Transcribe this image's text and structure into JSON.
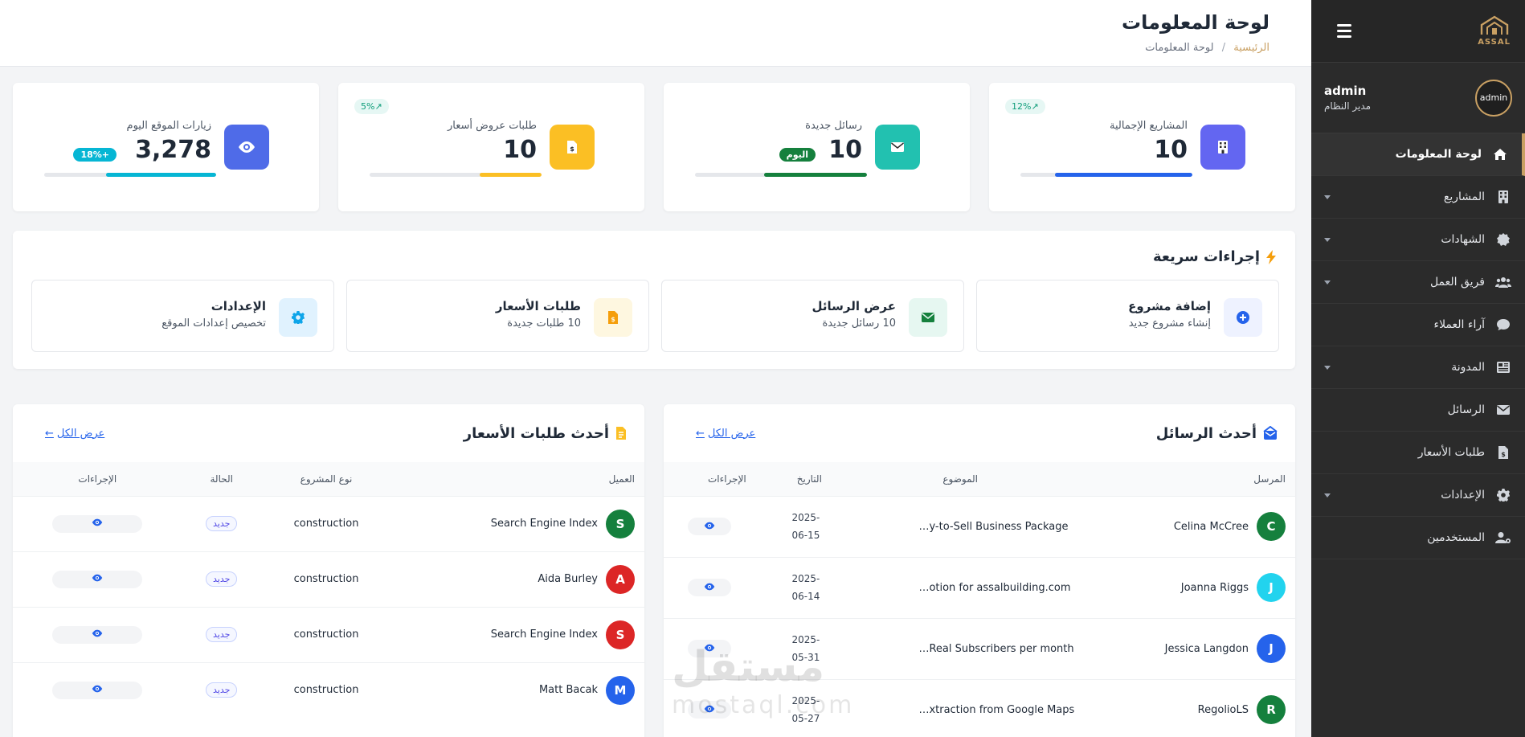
{
  "sidebar": {
    "logo_text": "ASSAL",
    "user": {
      "avatar_alt": "admin",
      "name": "admin",
      "role": "مدير النظام"
    },
    "items": [
      {
        "label": "لوحة المعلومات",
        "icon": "home-icon",
        "active": true,
        "caret": false
      },
      {
        "label": "المشاريع",
        "icon": "building-icon",
        "active": false,
        "caret": true
      },
      {
        "label": "الشهادات",
        "icon": "certificate-icon",
        "active": false,
        "caret": true
      },
      {
        "label": "فريق العمل",
        "icon": "team-icon",
        "active": false,
        "caret": true
      },
      {
        "label": "آراء العملاء",
        "icon": "comment-icon",
        "active": false,
        "caret": false
      },
      {
        "label": "المدونة",
        "icon": "newspaper-icon",
        "active": false,
        "caret": true
      },
      {
        "label": "الرسائل",
        "icon": "envelope-icon",
        "active": false,
        "caret": false
      },
      {
        "label": "طلبات الأسعار",
        "icon": "invoice-icon",
        "active": false,
        "caret": false
      },
      {
        "label": "الإعدادات",
        "icon": "gear-icon",
        "active": false,
        "caret": true
      },
      {
        "label": "المستخدمين",
        "icon": "user-cog-icon",
        "active": false,
        "caret": false
      }
    ]
  },
  "header": {
    "title": "لوحة المعلومات",
    "breadcrumb": {
      "home": "الرئيسية",
      "separator": "/",
      "current": "لوحة المعلومات"
    }
  },
  "stats": [
    {
      "label": "المشاريع الإجمالية",
      "value": "10",
      "pct": "12%",
      "color": "#6366f1",
      "bar_color": "#2563eb",
      "fill": 0.8,
      "icon": "building-icon"
    },
    {
      "label": "رسائل جديدة",
      "value": "10",
      "chip": "اليوم",
      "chip_color": "#15803d",
      "color": "#22c1b0",
      "bar_color": "#15803d",
      "fill": 0.6,
      "icon": "envelope-icon"
    },
    {
      "label": "طلبات عروض أسعار",
      "value": "10",
      "pct": "5%",
      "color": "#fbbf24",
      "bar_color": "#fbbf24",
      "fill": 0.36,
      "icon": "invoice-icon"
    },
    {
      "label": "زيارات الموقع اليوم",
      "value": "3,278",
      "chip": "+18%",
      "chip_color": "#06b6d4",
      "color": "#4f6be8",
      "bar_color": "#06b6d4",
      "fill": 0.64,
      "icon": "eye-icon"
    }
  ],
  "quick": {
    "title": "إجراءات سريعة",
    "actions": [
      {
        "title": "إضافة مشروع",
        "sub": "إنشاء مشروع جديد",
        "icon": "plus-circle-icon",
        "bg": "#eef2ff",
        "fg": "#2563eb"
      },
      {
        "title": "عرض الرسائل",
        "sub": "10 رسائل جديدة",
        "icon": "envelope-icon",
        "bg": "#e6f7f1",
        "fg": "#15803d"
      },
      {
        "title": "طلبات الأسعار",
        "sub": "10 طلبات جديدة",
        "icon": "invoice-icon",
        "bg": "#fef7e0",
        "fg": "#f59e0b"
      },
      {
        "title": "الإعدادات",
        "sub": "تخصيص إعدادات الموقع",
        "icon": "gear-icon",
        "bg": "#e0f2fe",
        "fg": "#0ea5e9"
      }
    ]
  },
  "messages": {
    "title": "أحدث الرسائل",
    "view_all": "عرض الكل",
    "columns": [
      "المرسل",
      "الموضوع",
      "التاريخ",
      "الإجراءات"
    ],
    "rows": [
      {
        "letter": "C",
        "color": "#15803d",
        "name": "Celina McCree",
        "subject": "…y-to-Sell Business Package",
        "date": "2025-06-15"
      },
      {
        "letter": "J",
        "color": "#22d3ee",
        "name": "Joanna Riggs",
        "subject": "…otion for assalbuilding.com",
        "date": "2025-06-14"
      },
      {
        "letter": "J",
        "color": "#2563eb",
        "name": "Jessica Langdon",
        "subject": "…Real Subscribers per month",
        "date": "2025-05-31"
      },
      {
        "letter": "R",
        "color": "#15803d",
        "name": "RegolioLS",
        "subject": "…xtraction from Google Maps",
        "date": "2025-05-27"
      }
    ]
  },
  "quotes": {
    "title": "أحدث طلبات الأسعار",
    "view_all": "عرض الكل",
    "columns": [
      "العميل",
      "نوع المشروع",
      "الحالة",
      "الإجراءات"
    ],
    "rows": [
      {
        "letter": "S",
        "color": "#15803d",
        "name": "Search Engine Index",
        "type": "construction",
        "status": "جديد"
      },
      {
        "letter": "A",
        "color": "#dc2626",
        "name": "Aida Burley",
        "type": "construction",
        "status": "جديد"
      },
      {
        "letter": "S",
        "color": "#dc2626",
        "name": "Search Engine Index",
        "type": "construction",
        "status": "جديد"
      },
      {
        "letter": "M",
        "color": "#2563eb",
        "name": "Matt Bacak",
        "type": "construction",
        "status": "جديد"
      }
    ]
  },
  "watermark": {
    "text": "مستقل",
    "sub": "mostaql.com"
  }
}
